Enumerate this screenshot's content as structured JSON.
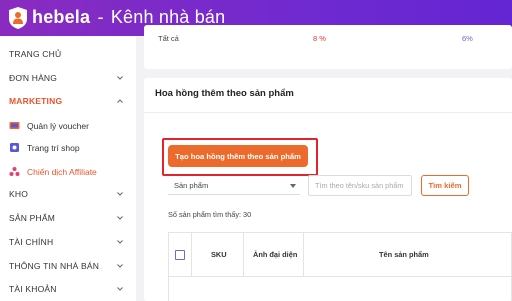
{
  "header": {
    "brand": "hebela",
    "separator": "-",
    "subtitle": "Kênh nhà bán"
  },
  "sidebar": {
    "items": [
      {
        "label": "TRANG CHỦ",
        "has_chevron": false
      },
      {
        "label": "ĐƠN HÀNG",
        "has_chevron": true
      },
      {
        "label": "MARKETING",
        "has_chevron": true,
        "active": true,
        "expanded": true
      },
      {
        "label": "KHO",
        "has_chevron": true
      },
      {
        "label": "SẢN PHẨM",
        "has_chevron": true
      },
      {
        "label": "TÀI CHÍNH",
        "has_chevron": true
      },
      {
        "label": "THÔNG TIN NHÀ BÁN",
        "has_chevron": true
      },
      {
        "label": "TÀI KHOẢN",
        "has_chevron": true
      }
    ],
    "marketing_sub": [
      {
        "label": "Quản lý voucher",
        "icon": "voucher-icon"
      },
      {
        "label": "Trang trí shop",
        "icon": "shop-decor-icon"
      },
      {
        "label": "Chiến dịch Affiliate",
        "icon": "affiliate-icon",
        "active": true
      }
    ]
  },
  "summary_row": {
    "label": "Tất cả",
    "value_1": "8 %",
    "value_2": "6%"
  },
  "main": {
    "section_title": "Hoa hồng thêm theo sản phẩm",
    "create_button": "Tạo hoa hồng thêm theo sản phẩm",
    "filter_select": "Sản phẩm",
    "search_placeholder": "Tìm theo tên/sku sản phẩm",
    "search_button": "Tìm kiếm",
    "result_count": "Số sản phẩm tìm thấy: 30",
    "table_headers": [
      "SKU",
      "Ảnh đại diện",
      "Tên sản phẩm"
    ]
  },
  "colors": {
    "header_gradient_start": "#8a2bc0",
    "header_gradient_end": "#6425d3",
    "accent_orange": "#ec6a2c",
    "active_text": "#e8542f",
    "highlight_red": "#e0262c"
  }
}
